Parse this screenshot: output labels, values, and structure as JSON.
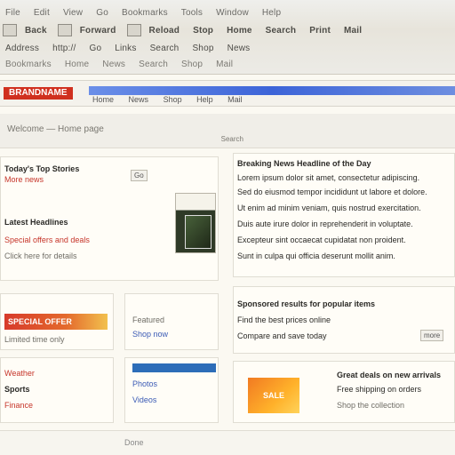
{
  "topbar": {
    "row1": [
      "File",
      "Edit",
      "View",
      "Go",
      "Bookmarks",
      "Tools",
      "Window",
      "Help"
    ],
    "row2": [
      "Back",
      "Forward",
      "Reload",
      "Stop",
      "Home",
      "Search",
      "Print",
      "Mail"
    ],
    "row3": [
      "Address",
      "http://",
      "Go",
      "Links",
      "Search",
      "Shop",
      "News"
    ],
    "row4": [
      "Bookmarks",
      "Home",
      "News",
      "Search",
      "Shop",
      "Mail"
    ]
  },
  "navstrip": {
    "brand": "BRANDNAME",
    "items": [
      "Home",
      "News",
      "Shop",
      "Help",
      "Mail"
    ]
  },
  "subbar": {
    "left": "Welcome — Home page",
    "right": "Search"
  },
  "left_top": {
    "line1": "Today's Top Stories",
    "line2": "More news",
    "line3": "Latest Headlines",
    "line4": "Special offers and deals",
    "line5": "Click here for details",
    "button": "Go"
  },
  "right_top": {
    "headline": "Breaking News Headline of the Day",
    "lines": [
      "Lorem ipsum dolor sit amet, consectetur adipiscing.",
      "Sed do eiusmod tempor incididunt ut labore et dolore.",
      "Ut enim ad minim veniam, quis nostrud exercitation.",
      "Duis aute irure dolor in reprehenderit in voluptate.",
      "Excepteur sint occaecat cupidatat non proident.",
      "Sunt in culpa qui officia deserunt mollit anim."
    ]
  },
  "left_mid": {
    "banner": "SPECIAL OFFER",
    "line1": "Limited time only"
  },
  "mid_mid": {
    "line1": "Featured",
    "line2": "Shop now"
  },
  "right_mid": {
    "line1": "Sponsored results for popular items",
    "line2": "Find the best prices online",
    "line3": "Compare and save today",
    "more": "more"
  },
  "left_bot": {
    "line1": "Weather",
    "line2": "Sports",
    "line3": "Finance"
  },
  "mid_bot": {
    "line1": "Photos",
    "line2": "Videos"
  },
  "right_bot": {
    "badge": "SALE",
    "line1": "Great deals on new arrivals",
    "line2": "Free shipping on orders",
    "line3": "Shop the collection"
  },
  "footer": {
    "text": "Done"
  },
  "colors": {
    "accent_red": "#d0301f",
    "accent_blue": "#3c64d8",
    "accent_orange": "#f17a22"
  }
}
